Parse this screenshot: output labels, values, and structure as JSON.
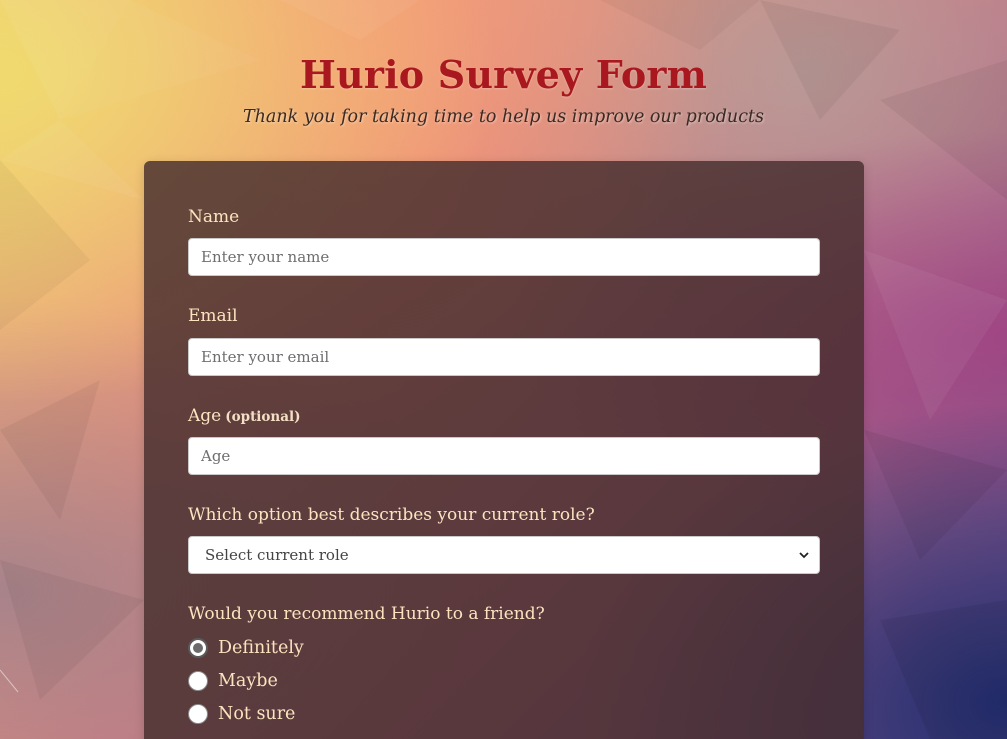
{
  "header": {
    "title": "Hurio Survey Form",
    "subtitle": "Thank you for taking time to help us improve our products"
  },
  "form": {
    "name": {
      "label": "Name",
      "placeholder": "Enter your name",
      "value": ""
    },
    "email": {
      "label": "Email",
      "placeholder": "Enter your email",
      "value": ""
    },
    "age": {
      "label": "Age",
      "optional_text": "(optional)",
      "placeholder": "Age",
      "value": ""
    },
    "role": {
      "label": "Which option best describes your current role?",
      "selected": "Select current role"
    },
    "recommend": {
      "label": "Would you recommend Hurio to a friend?",
      "options": [
        {
          "label": "Definitely",
          "checked": true
        },
        {
          "label": "Maybe",
          "checked": false
        },
        {
          "label": "Not sure",
          "checked": false
        }
      ]
    }
  },
  "colors": {
    "title": "#a8181e",
    "label": "#fbe4bf",
    "card": "#462d2d"
  }
}
